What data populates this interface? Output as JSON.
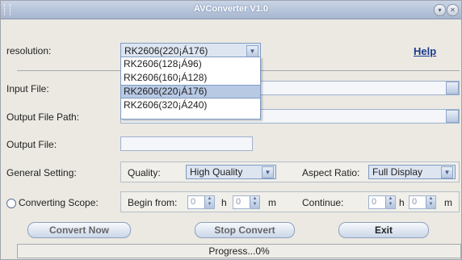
{
  "window": {
    "title": "AVConverter V1.0"
  },
  "titlebar_buttons": [
    {
      "icon": "chevron-down-icon",
      "glyph": "▾"
    },
    {
      "icon": "close-icon",
      "glyph": "✕"
    }
  ],
  "resolution": {
    "label": "resolution:",
    "selected": "RK2606(220¡Á176)",
    "options": [
      "RK2606(128¡Á96)",
      "RK2606(160¡Á128)",
      "RK2606(220¡Á176)",
      "RK2606(320¡Á240)"
    ],
    "selected_index": 2
  },
  "help_link": "Help",
  "fields": {
    "input_file": {
      "label": "Input File:",
      "value": ""
    },
    "output_file_path": {
      "label": "Output File Path:",
      "value": ""
    },
    "output_file": {
      "label": "Output File:",
      "value": ""
    }
  },
  "general": {
    "label": "General Setting:",
    "quality_label": "Quality:",
    "quality_value": "High Quality",
    "aspect_label": "Aspect Ratio:",
    "aspect_value": "Full Display"
  },
  "scope": {
    "label": "Converting Scope:",
    "begin_label": "Begin from:",
    "begin_h": "0",
    "begin_m": "0",
    "h_unit": "h",
    "m_unit": "m",
    "continue_label": "Continue:",
    "cont_h": "0",
    "cont_m": "0"
  },
  "buttons": {
    "convert": "Convert Now",
    "stop": "Stop Convert",
    "exit": "Exit"
  },
  "progress": {
    "text": "Progress...0%",
    "value": 0
  },
  "colors": {
    "title_bg": "#a7b6cf",
    "link": "#1a3a8e",
    "selection": "#b8c9e4"
  }
}
